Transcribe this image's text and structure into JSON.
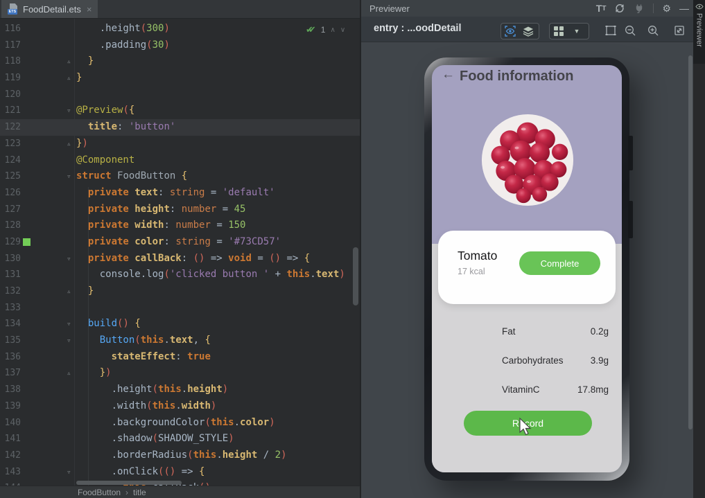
{
  "colors": {
    "editor_bg": "#2a2c2e",
    "caret_row": "#35373a",
    "panel_bg": "#3c4145",
    "canvas_bg": "#40454a",
    "accent_blue": "#4a8fd6",
    "phone_lavender": "#a4a1c0",
    "phone_gray": "#d5d4d6",
    "button_green_complete": "#69c457",
    "button_green_record": "#5cb84a",
    "code_color_swatch": "#73CD57"
  },
  "editor": {
    "tab": {
      "title": "FoodDetail.ets",
      "close_glyph": "×",
      "badge": "ETS"
    },
    "inspection": {
      "check_glyph": "✔✔",
      "ok_count": "1",
      "up_glyph": "∧",
      "down_glyph": "∨"
    },
    "breadcrumb": {
      "items": [
        "FoodButton",
        "title"
      ],
      "separator": "›"
    },
    "lines": [
      {
        "n": "116",
        "f": "",
        "s": false,
        "c": false,
        "t": [
          [
            "ws",
            "    "
          ],
          [
            "pln",
            ".height"
          ],
          [
            "par",
            "("
          ],
          [
            "num",
            "300"
          ],
          [
            "par",
            ")"
          ]
        ]
      },
      {
        "n": "117",
        "f": "",
        "s": false,
        "c": false,
        "t": [
          [
            "ws",
            "    "
          ],
          [
            "pln",
            ".padding"
          ],
          [
            "par",
            "("
          ],
          [
            "num",
            "30"
          ],
          [
            "par",
            ")"
          ]
        ]
      },
      {
        "n": "118",
        "f": "e",
        "s": false,
        "c": false,
        "t": [
          [
            "ws",
            "  "
          ],
          [
            "brc",
            "}"
          ]
        ]
      },
      {
        "n": "119",
        "f": "e",
        "s": false,
        "c": false,
        "t": [
          [
            "brc",
            "}"
          ]
        ]
      },
      {
        "n": "120",
        "f": "",
        "s": false,
        "c": false,
        "t": []
      },
      {
        "n": "121",
        "f": "o",
        "s": false,
        "c": false,
        "t": [
          [
            "ann",
            "@Preview"
          ],
          [
            "par",
            "("
          ],
          [
            "brc",
            "{"
          ]
        ]
      },
      {
        "n": "122",
        "f": "",
        "s": false,
        "c": true,
        "t": [
          [
            "ws",
            "  "
          ],
          [
            "prop",
            "title"
          ],
          [
            "pln",
            ": "
          ],
          [
            "str",
            "'button'"
          ]
        ]
      },
      {
        "n": "123",
        "f": "e",
        "s": false,
        "c": false,
        "t": [
          [
            "brc",
            "}"
          ],
          [
            "par",
            ")"
          ]
        ]
      },
      {
        "n": "124",
        "f": "",
        "s": false,
        "c": false,
        "t": [
          [
            "ann",
            "@Component"
          ]
        ]
      },
      {
        "n": "125",
        "f": "o",
        "s": false,
        "c": false,
        "t": [
          [
            "kw",
            "struct "
          ],
          [
            "dim",
            "FoodButton "
          ],
          [
            "brc",
            "{"
          ]
        ]
      },
      {
        "n": "126",
        "f": "",
        "s": false,
        "c": false,
        "t": [
          [
            "ws",
            "  "
          ],
          [
            "kw",
            "private "
          ],
          [
            "prop",
            "text"
          ],
          [
            "pln",
            ": "
          ],
          [
            "typ",
            "string"
          ],
          [
            "pln",
            " = "
          ],
          [
            "str",
            "'default'"
          ]
        ]
      },
      {
        "n": "127",
        "f": "",
        "s": false,
        "c": false,
        "t": [
          [
            "ws",
            "  "
          ],
          [
            "kw",
            "private "
          ],
          [
            "prop",
            "height"
          ],
          [
            "pln",
            ": "
          ],
          [
            "typ",
            "number"
          ],
          [
            "pln",
            " = "
          ],
          [
            "num",
            "45"
          ]
        ]
      },
      {
        "n": "128",
        "f": "",
        "s": false,
        "c": false,
        "t": [
          [
            "ws",
            "  "
          ],
          [
            "kw",
            "private "
          ],
          [
            "prop",
            "width"
          ],
          [
            "pln",
            ": "
          ],
          [
            "typ",
            "number"
          ],
          [
            "pln",
            " = "
          ],
          [
            "num",
            "150"
          ]
        ]
      },
      {
        "n": "129",
        "f": "",
        "s": true,
        "c": false,
        "t": [
          [
            "ws",
            "  "
          ],
          [
            "kw",
            "private "
          ],
          [
            "prop",
            "color"
          ],
          [
            "pln",
            ": "
          ],
          [
            "typ",
            "string"
          ],
          [
            "pln",
            " = "
          ],
          [
            "str",
            "'#73CD57'"
          ]
        ]
      },
      {
        "n": "130",
        "f": "o",
        "s": false,
        "c": false,
        "t": [
          [
            "ws",
            "  "
          ],
          [
            "kw",
            "private "
          ],
          [
            "prop",
            "callBack"
          ],
          [
            "pln",
            ": "
          ],
          [
            "par",
            "()"
          ],
          [
            "pln",
            " => "
          ],
          [
            "kw",
            "void"
          ],
          [
            "pln",
            " = "
          ],
          [
            "par",
            "()"
          ],
          [
            "pln",
            " => "
          ],
          [
            "brc",
            "{"
          ]
        ]
      },
      {
        "n": "131",
        "f": "",
        "s": false,
        "c": false,
        "t": [
          [
            "ws",
            "    "
          ],
          [
            "pln",
            "console.log"
          ],
          [
            "par",
            "("
          ],
          [
            "str",
            "'clicked button '"
          ],
          [
            "pln",
            " + "
          ],
          [
            "kw",
            "this"
          ],
          [
            "pln",
            "."
          ],
          [
            "prop",
            "text"
          ],
          [
            "par",
            ")"
          ]
        ]
      },
      {
        "n": "132",
        "f": "e",
        "s": false,
        "c": false,
        "t": [
          [
            "ws",
            "  "
          ],
          [
            "brc",
            "}"
          ]
        ]
      },
      {
        "n": "133",
        "f": "",
        "s": false,
        "c": false,
        "t": []
      },
      {
        "n": "134",
        "f": "o",
        "s": false,
        "c": false,
        "t": [
          [
            "ws",
            "  "
          ],
          [
            "fn",
            "build"
          ],
          [
            "par",
            "()"
          ],
          [
            "pln",
            " "
          ],
          [
            "brc",
            "{"
          ]
        ]
      },
      {
        "n": "135",
        "f": "o",
        "s": false,
        "c": false,
        "t": [
          [
            "ws",
            "    "
          ],
          [
            "fn",
            "Button"
          ],
          [
            "par",
            "("
          ],
          [
            "kw",
            "this"
          ],
          [
            "pln",
            "."
          ],
          [
            "prop",
            "text"
          ],
          [
            "pln",
            ", "
          ],
          [
            "brc",
            "{"
          ]
        ]
      },
      {
        "n": "136",
        "f": "",
        "s": false,
        "c": false,
        "t": [
          [
            "ws",
            "      "
          ],
          [
            "prop",
            "stateEffect"
          ],
          [
            "pln",
            ": "
          ],
          [
            "kw",
            "true"
          ]
        ]
      },
      {
        "n": "137",
        "f": "e",
        "s": false,
        "c": false,
        "t": [
          [
            "ws",
            "    "
          ],
          [
            "brc",
            "}"
          ],
          [
            "par",
            ")"
          ]
        ]
      },
      {
        "n": "138",
        "f": "",
        "s": false,
        "c": false,
        "t": [
          [
            "ws",
            "      "
          ],
          [
            "pln",
            ".height"
          ],
          [
            "par",
            "("
          ],
          [
            "kw",
            "this"
          ],
          [
            "pln",
            "."
          ],
          [
            "prop",
            "height"
          ],
          [
            "par",
            ")"
          ]
        ]
      },
      {
        "n": "139",
        "f": "",
        "s": false,
        "c": false,
        "t": [
          [
            "ws",
            "      "
          ],
          [
            "pln",
            ".width"
          ],
          [
            "par",
            "("
          ],
          [
            "kw",
            "this"
          ],
          [
            "pln",
            "."
          ],
          [
            "prop",
            "width"
          ],
          [
            "par",
            ")"
          ]
        ]
      },
      {
        "n": "140",
        "f": "",
        "s": false,
        "c": false,
        "t": [
          [
            "ws",
            "      "
          ],
          [
            "pln",
            ".backgroundColor"
          ],
          [
            "par",
            "("
          ],
          [
            "kw",
            "this"
          ],
          [
            "pln",
            "."
          ],
          [
            "prop",
            "color"
          ],
          [
            "par",
            ")"
          ]
        ]
      },
      {
        "n": "141",
        "f": "",
        "s": false,
        "c": false,
        "t": [
          [
            "ws",
            "      "
          ],
          [
            "pln",
            ".shadow"
          ],
          [
            "par",
            "("
          ],
          [
            "pln",
            "SHADOW_STYLE"
          ],
          [
            "par",
            ")"
          ]
        ]
      },
      {
        "n": "142",
        "f": "",
        "s": false,
        "c": false,
        "t": [
          [
            "ws",
            "      "
          ],
          [
            "pln",
            ".borderRadius"
          ],
          [
            "par",
            "("
          ],
          [
            "kw",
            "this"
          ],
          [
            "pln",
            "."
          ],
          [
            "prop",
            "height"
          ],
          [
            "pln",
            " / "
          ],
          [
            "num",
            "2"
          ],
          [
            "par",
            ")"
          ]
        ]
      },
      {
        "n": "143",
        "f": "o",
        "s": false,
        "c": false,
        "t": [
          [
            "ws",
            "      "
          ],
          [
            "pln",
            ".onClick"
          ],
          [
            "par",
            "(()"
          ],
          [
            "pln",
            " => "
          ],
          [
            "brc",
            "{"
          ]
        ]
      },
      {
        "n": "144",
        "f": "",
        "s": false,
        "c": false,
        "t": [
          [
            "ws",
            "        "
          ],
          [
            "kw",
            "this"
          ],
          [
            "pln",
            "."
          ],
          [
            "pln",
            "callBack"
          ],
          [
            "par",
            "()"
          ]
        ]
      }
    ]
  },
  "previewer": {
    "panel_title": "Previewer",
    "target_label": "entry : ...oodDetail",
    "tt_label_big": "T",
    "tt_label_small": "T",
    "dropdown_glyph": "▼",
    "minimize_glyph": "—",
    "header_icons": [
      "text-scale-icon",
      "refresh-icon",
      "connect-plug-icon",
      "settings-gear-icon",
      "minimize-icon"
    ],
    "toolbar_icons": [
      "inspect-eye-icon",
      "layers-icon",
      "grid-view-icon",
      "dropdown-arrow-icon",
      "frame-select-icon",
      "zoom-out-icon",
      "zoom-in-icon",
      "fit-screen-icon"
    ],
    "side_tab": {
      "label": "Previewer",
      "icon": "eye-icon"
    }
  },
  "phone": {
    "header": {
      "back_glyph": "←",
      "title": "Food information"
    },
    "image_alt": "bowl of red tomatoes",
    "food": {
      "name": "Tomato",
      "calories": "17 kcal"
    },
    "buttons": {
      "complete": "Complete",
      "record": "Record"
    },
    "nutrition": [
      {
        "label": "Fat",
        "value": "0.2g"
      },
      {
        "label": "Carbohydrates",
        "value": "3.9g"
      },
      {
        "label": "VitaminC",
        "value": "17.8mg"
      }
    ]
  }
}
